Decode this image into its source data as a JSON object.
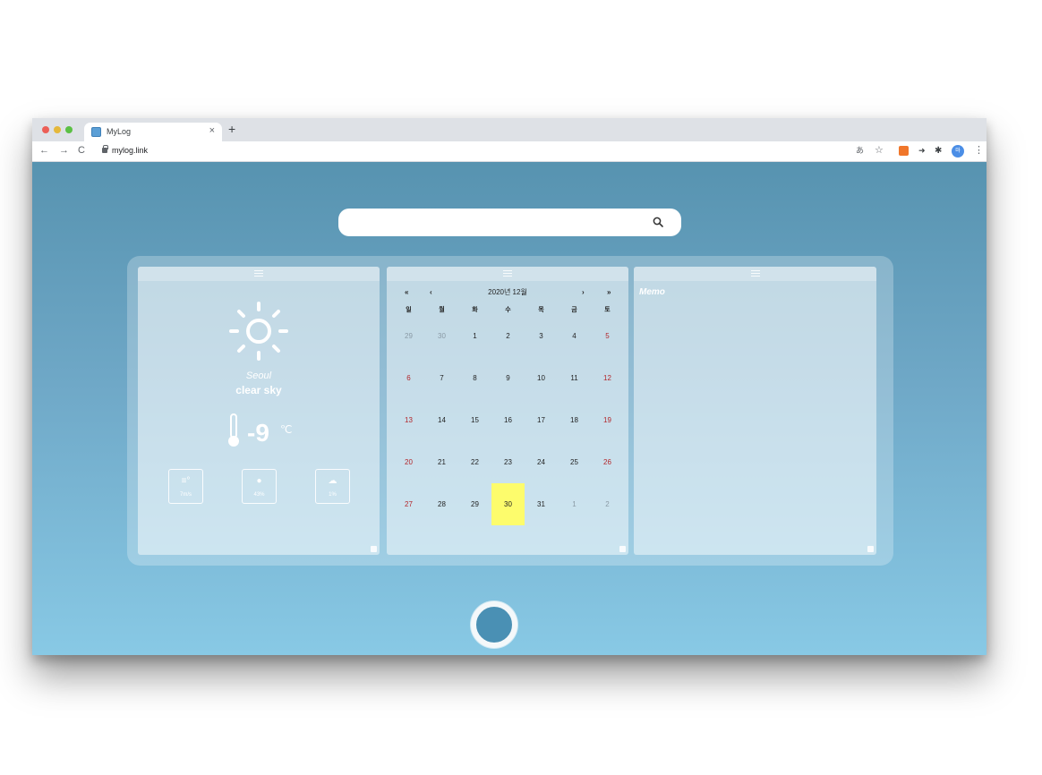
{
  "browser": {
    "tab_title": "MyLog",
    "tab_close": "×",
    "new_tab": "+",
    "back": "←",
    "forward": "→",
    "reload": "C",
    "url": "mylog.link",
    "star": "☆",
    "avatar": "마",
    "menu": "⋮"
  },
  "search": {
    "placeholder": ""
  },
  "weather": {
    "icon": "sun-icon",
    "city": "Seoul",
    "condition": "clear sky",
    "temperature": "-9",
    "unit": "℃",
    "stats": {
      "wind": "7m/s",
      "humidity": "43%",
      "cloud": "1%"
    }
  },
  "calendar": {
    "title": "2020년 12월",
    "nav": {
      "prev_year": "«",
      "prev_month": "‹",
      "next_month": "›",
      "next_year": "»"
    },
    "weekdays": [
      "일",
      "월",
      "화",
      "수",
      "목",
      "금",
      "토"
    ],
    "weeks": [
      [
        "29",
        "30",
        "1",
        "2",
        "3",
        "4",
        "5"
      ],
      [
        "6",
        "7",
        "8",
        "9",
        "10",
        "11",
        "12"
      ],
      [
        "13",
        "14",
        "15",
        "16",
        "17",
        "18",
        "19"
      ],
      [
        "20",
        "21",
        "22",
        "23",
        "24",
        "25",
        "26"
      ],
      [
        "27",
        "28",
        "29",
        "30",
        "31",
        "1",
        "2"
      ]
    ],
    "today": "30"
  },
  "memo": {
    "title": "Memo"
  },
  "colors": {
    "page_top": "#5793b0",
    "page_bottom": "#88c9e5",
    "today_highlight": "#fdfc6c",
    "weekend_red": "#b3262a"
  }
}
